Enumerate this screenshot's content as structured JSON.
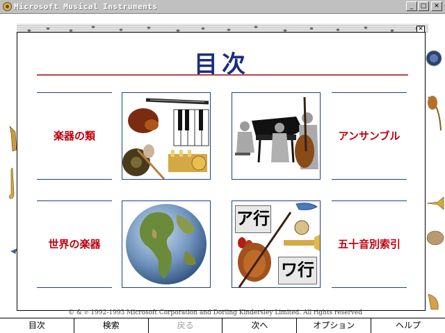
{
  "window": {
    "title": "Microsoft Musical Instruments",
    "minimize_glyph": "_",
    "maximize_glyph": "□",
    "close_glyph": "✕"
  },
  "dialog": {
    "heading": "目次",
    "close_glyph": "✕",
    "categories": [
      {
        "label": "楽器の類",
        "thumb_icon": "instrument-collage-icon"
      },
      {
        "label": "アンサンブル",
        "thumb_icon": "ensemble-musicians-icon"
      },
      {
        "label": "世界の楽器",
        "thumb_icon": "globe-icon"
      },
      {
        "label": "五十音別索引",
        "thumb_icon": "kana-index-icon"
      }
    ],
    "kana_a": "ア行",
    "kana_wa": "ワ行"
  },
  "copyright": "© & ℗ 1992-1993 Microsoft Corporation and Dorling Kindersley Limited. All rights reserved",
  "navbar": {
    "items": [
      {
        "label": "目次",
        "enabled": true
      },
      {
        "label": "検索",
        "enabled": true
      },
      {
        "label": "戻る",
        "enabled": false
      },
      {
        "label": "次へ",
        "enabled": true
      },
      {
        "label": "オプション",
        "enabled": true
      },
      {
        "label": "ヘルプ",
        "enabled": true
      }
    ]
  },
  "colors": {
    "heading": "#1b2f7e",
    "category_label": "#c00010",
    "rule": "#b3444a",
    "titlebar": "#c0c0c0"
  }
}
